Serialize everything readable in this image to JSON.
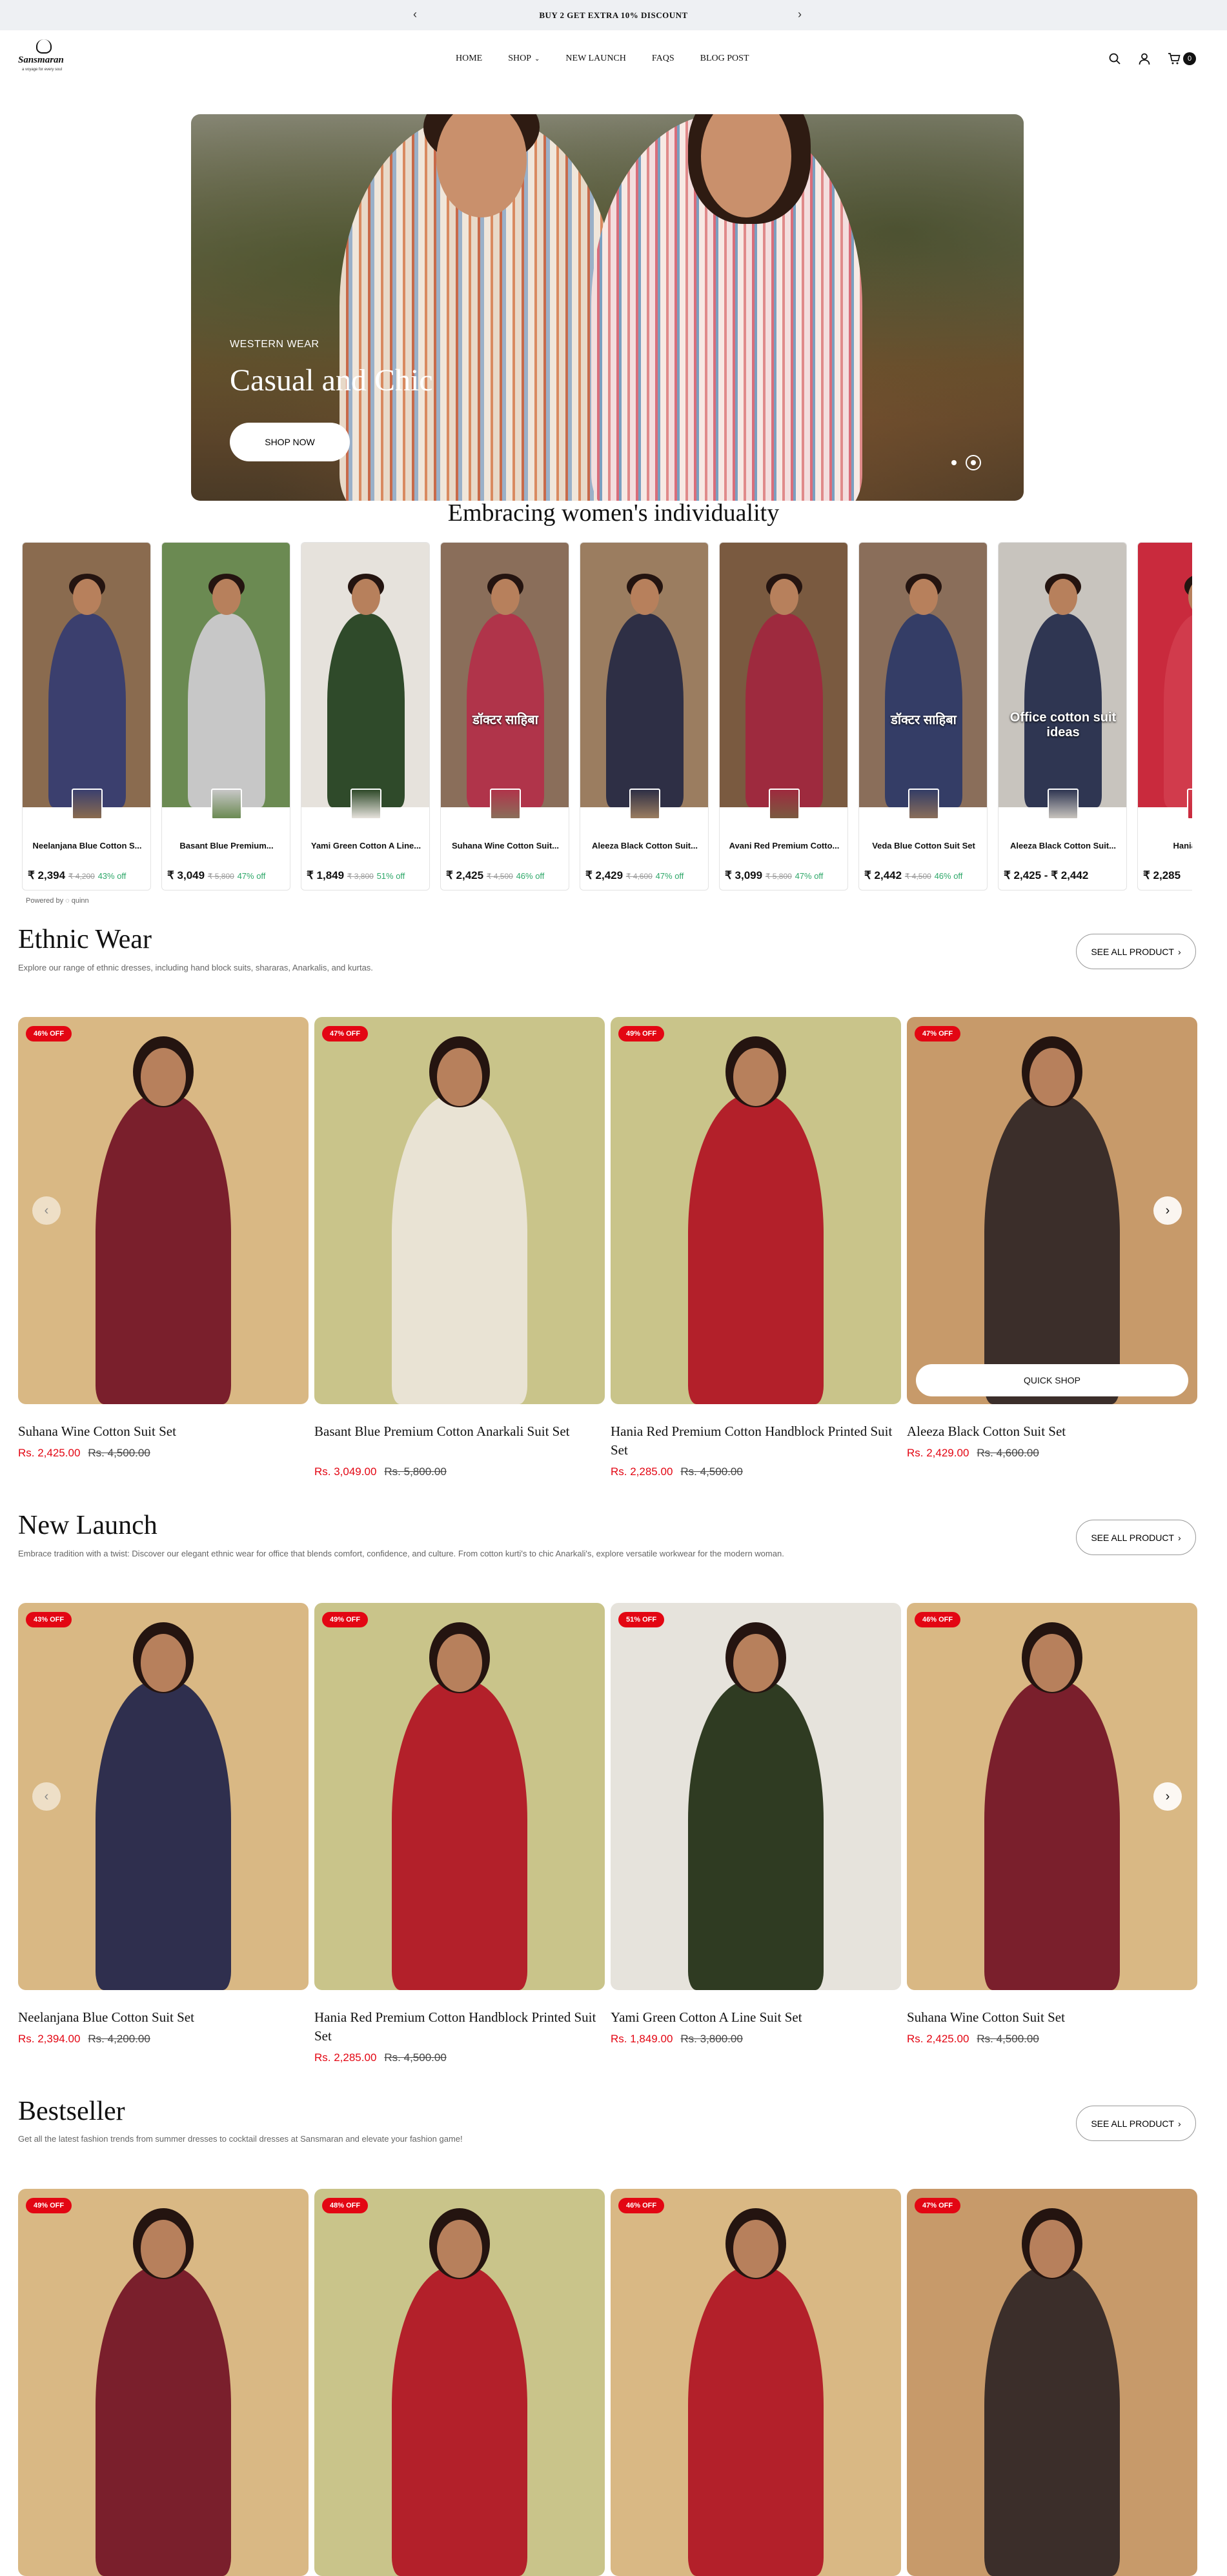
{
  "announcement": {
    "text": "BUY 2 GET EXTRA 10% DISCOUNT",
    "prev": "‹",
    "next": "›"
  },
  "brand": {
    "name": "Sansmaran",
    "tagline": "a voyage for every soul"
  },
  "nav": {
    "items": [
      "HOME",
      "SHOP",
      "NEW LAUNCH",
      "FAQS",
      "BLOG POST"
    ],
    "shop_chevron": "⌄"
  },
  "header_icons": [
    "search-icon",
    "user-icon",
    "cart-icon"
  ],
  "cart": {
    "count": "0"
  },
  "hero": {
    "subtitle": "WESTERN WEAR",
    "title": "Casual and Chic",
    "cta": "SHOP NOW",
    "slides": 2,
    "active_slide": 2
  },
  "reels": {
    "title": "Embracing women's individuality",
    "powered_by": "Powered by ◌ quinn",
    "items": [
      {
        "name": "Neelanjana Blue Cotton S...",
        "price": "₹ 2,394",
        "was": "₹ 4,200",
        "off": "43% off",
        "overlay": ""
      },
      {
        "name": "Basant Blue Premium...",
        "price": "₹ 3,049",
        "was": "₹ 5,800",
        "off": "47% off",
        "overlay": ""
      },
      {
        "name": "Yami Green Cotton A Line...",
        "price": "₹ 1,849",
        "was": "₹ 3,800",
        "off": "51% off",
        "overlay": ""
      },
      {
        "name": "Suhana Wine Cotton Suit...",
        "price": "₹ 2,425",
        "was": "₹ 4,500",
        "off": "46% off",
        "overlay": "डॉक्टर साहिबा"
      },
      {
        "name": "Aleeza Black Cotton Suit...",
        "price": "₹ 2,429",
        "was": "₹ 4,600",
        "off": "47% off",
        "overlay": ""
      },
      {
        "name": "Avani Red Premium Cotto...",
        "price": "₹ 3,099",
        "was": "₹ 5,800",
        "off": "47% off",
        "overlay": ""
      },
      {
        "name": "Veda Blue Cotton Suit Set",
        "price": "₹ 2,442",
        "was": "₹ 4,500",
        "off": "46% off",
        "overlay": "डॉक्टर साहिबा"
      },
      {
        "name": "Aleeza Black Cotton Suit...",
        "price": "₹ 2,425 - ₹ 2,442",
        "was": "",
        "off": "",
        "overlay": "Office cotton suit ideas"
      },
      {
        "name": "Hania Red Pr...",
        "price": "₹ 2,285",
        "was": "",
        "off": "",
        "overlay": ""
      }
    ]
  },
  "ethnic": {
    "title": "Ethnic Wear",
    "desc": "Explore our range of ethnic dresses, including hand block suits, shararas, Anarkalis, and kurtas.",
    "see_all": "SEE ALL PRODUCT",
    "quick_shop": "QUICK SHOP",
    "products": [
      {
        "badge": "46% OFF",
        "title": "Suhana Wine Cotton Suit Set",
        "price": "Rs. 2,425.00",
        "was": "Rs. 4,500.00"
      },
      {
        "badge": "47% OFF",
        "title": "Basant Blue Premium Cotton Anarkali Suit Set",
        "price": "Rs. 3,049.00",
        "was": "Rs. 5,800.00"
      },
      {
        "badge": "49% OFF",
        "title": "Hania Red Premium Cotton Handblock Printed Suit Set",
        "price": "Rs. 2,285.00",
        "was": "Rs. 4,500.00"
      },
      {
        "badge": "47% OFF",
        "title": "Aleeza Black Cotton Suit Set",
        "price": "Rs. 2,429.00",
        "was": "Rs. 4,600.00"
      }
    ]
  },
  "newlaunch": {
    "title": "New Launch",
    "desc": "Embrace tradition with a twist: Discover our elegant ethnic wear for office that blends comfort, confidence, and culture. From cotton kurti's to chic Anarkali's, explore versatile workwear for the modern woman.",
    "see_all": "SEE ALL PRODUCT",
    "products": [
      {
        "badge": "43% OFF",
        "title": "Neelanjana Blue Cotton Suit Set",
        "price": "Rs. 2,394.00",
        "was": "Rs. 4,200.00"
      },
      {
        "badge": "49% OFF",
        "title": "Hania Red Premium Cotton Handblock Printed Suit Set",
        "price": "Rs. 2,285.00",
        "was": "Rs. 4,500.00"
      },
      {
        "badge": "51% OFF",
        "title": "Yami Green Cotton A Line Suit Set",
        "price": "Rs. 1,849.00",
        "was": "Rs. 3,800.00"
      },
      {
        "badge": "46% OFF",
        "title": "Suhana Wine Cotton Suit Set",
        "price": "Rs. 2,425.00",
        "was": "Rs. 4,500.00"
      }
    ]
  },
  "bestseller": {
    "title": "Bestseller",
    "desc": "Get all the latest fashion trends from summer dresses to cocktail dresses at Sansmaran and elevate your fashion game!",
    "see_all": "SEE ALL PRODUCT",
    "badges": [
      "49% OFF",
      "48% OFF",
      "46% OFF",
      "47% OFF"
    ]
  },
  "colors": {
    "sale_red": "#e30613",
    "discount_green": "#2fa86a",
    "announce_bg": "#eef0f3"
  }
}
